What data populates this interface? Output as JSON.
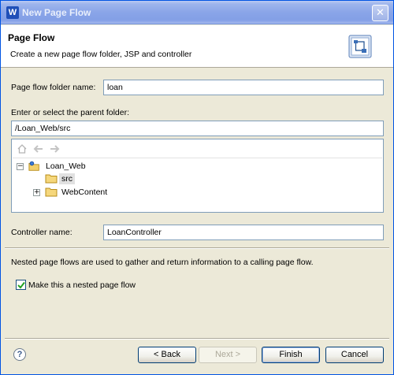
{
  "window": {
    "title": "New Page Flow",
    "close_glyph": "✕",
    "app_icon_glyph": "W"
  },
  "header": {
    "title": "Page Flow",
    "description": "Create a new page flow folder, JSP and controller",
    "icon": "page-flow-wizard-icon"
  },
  "form": {
    "folder_name_label": "Page flow folder name:",
    "folder_name_value": "loan",
    "parent_folder_label": "Enter or select the parent folder:",
    "parent_folder_value": "/Loan_Web/src",
    "controller_label": "Controller name:",
    "controller_value": "LoanController",
    "nested_info": "Nested page flows are used to gather and return information to a calling page flow.",
    "nested_checkbox_label": "Make this a nested page flow",
    "nested_checked": true
  },
  "tree": {
    "toolbar": [
      "home-icon",
      "back-arrow-icon",
      "forward-arrow-icon"
    ],
    "nodes": [
      {
        "label": "Loan_Web",
        "expander": "−",
        "icon": "project-folder-icon"
      },
      {
        "label": "src",
        "selected": true,
        "icon": "folder-icon"
      },
      {
        "label": "WebContent",
        "expander": "+",
        "icon": "folder-icon"
      }
    ]
  },
  "footer": {
    "help_glyph": "?",
    "back_label": "< Back",
    "next_label": "Next >",
    "finish_label": "Finish",
    "cancel_label": "Cancel"
  }
}
